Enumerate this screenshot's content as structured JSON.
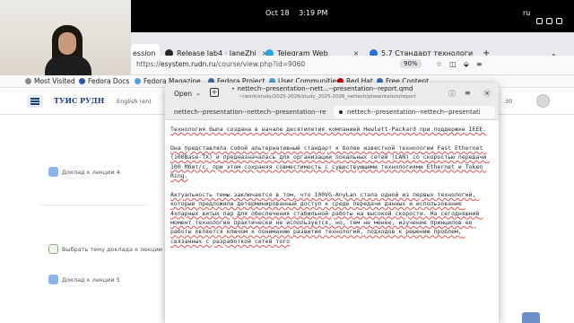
{
  "topbar": {
    "date": "Oct 18",
    "time": "3:19 PM",
    "input_lang": "ru"
  },
  "browser": {
    "tabs": [
      {
        "label": "ession",
        "close": "×",
        "color": "#b0b0b0"
      },
      {
        "label": "Release lab4 · JaneZhi",
        "close": "×",
        "color": "#24292f"
      },
      {
        "label": "Telegram Web",
        "close": "×",
        "color": "#2aa3e0"
      },
      {
        "label": "5.7 Стандарт технологи",
        "close": "×",
        "color": "#2c6fd6"
      }
    ],
    "url_prefix": "https://",
    "url_host": "esystem.rudn.ru",
    "url_path": "/course/view.php?id=9060",
    "zoom": "90%"
  },
  "bookmarks": [
    {
      "label": "Most Visited",
      "color": "#8a8a8a"
    },
    {
      "label": "Fedora Docs",
      "color": "#2c5aa0"
    },
    {
      "label": "Fedora Magazine",
      "color": "#51a2da"
    },
    {
      "label": "Fedora Project",
      "color": "#3c6eb4"
    },
    {
      "label": "User Communities",
      "color": "#51a2da"
    },
    {
      "label": "Red Hat",
      "color": "#cc0000"
    },
    {
      "label": "Free Content",
      "color": "#3c6eb4"
    }
  ],
  "moodle": {
    "logo": "ТУИС РУДН",
    "lang": "English (en)",
    "user_initials": "30",
    "items": [
      "Доклад к лекции 4",
      "Выбрать тему доклада к лекции 5",
      "Доклад к лекции 5"
    ]
  },
  "editor": {
    "open_label": "Open",
    "title": "nettech--presentation--nett...--presentation--report.qmd",
    "subtitle": "~/work/study/2025-2026/study_2025-2026_nettech/presentation/report",
    "tabs": [
      "nettech--presentation--nettech--presentation--re",
      "nettech--presentation--nettech--presentati"
    ],
    "close_label": "×",
    "paragraphs": [
      "Технология была создана в начале десятилетия компанией Hewlett-Packard при поддержке IEEE.",
      "Она представляла собой альтернативный стандарт к более известной технологии Fast Ethernet (100Base-TX) и предназначалась для организации локальных сетей (LAN) со скоростью передачи 100 Мбит/с, при этом сохраняя совместимость с существующими технологиями Ethernet и Token Ring.",
      "Актуальность темы заключается в том, что 100VG-AnyLan стала одной из первых технологий, которые предложили детерминированный доступ к среде передачи данных и использование 4хпарных витых пар для обеспечения стабильной работы на высокой скорости. На сегодняшний момент технология практически не используется, но, тем не менее, изучение принципов ее работы является ключом к пониманию развития технологий, подходов к решению проблем, связанных с разработкой сетей того"
    ]
  }
}
